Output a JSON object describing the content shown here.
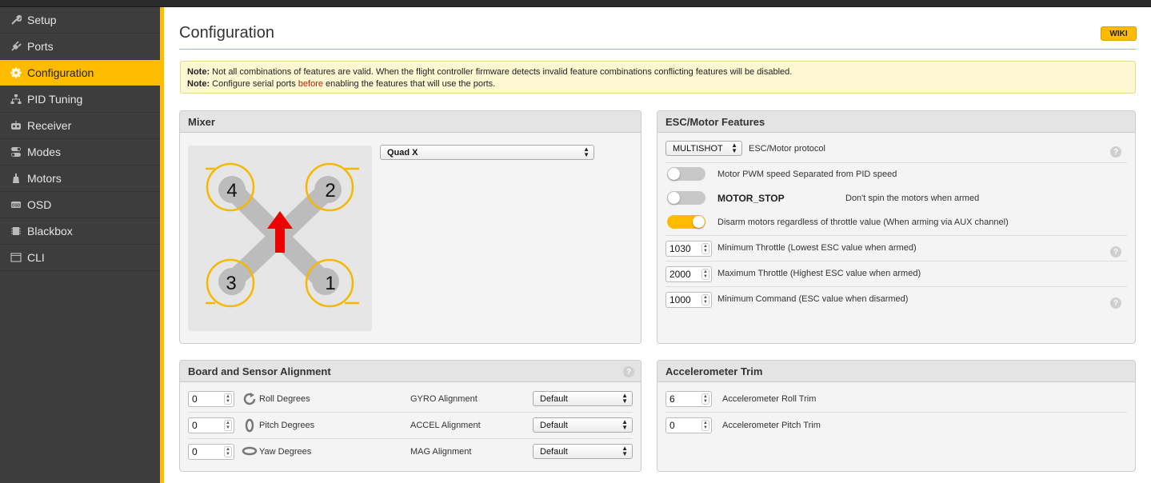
{
  "sidebar": {
    "items": [
      {
        "label": "Setup",
        "icon": "wrench-icon"
      },
      {
        "label": "Ports",
        "icon": "plug-icon"
      },
      {
        "label": "Configuration",
        "icon": "gear-icon"
      },
      {
        "label": "PID Tuning",
        "icon": "sitemap-icon"
      },
      {
        "label": "Receiver",
        "icon": "remote-icon"
      },
      {
        "label": "Modes",
        "icon": "toggles-icon"
      },
      {
        "label": "Motors",
        "icon": "motor-icon"
      },
      {
        "label": "OSD",
        "icon": "osd-icon"
      },
      {
        "label": "Blackbox",
        "icon": "blackbox-icon"
      },
      {
        "label": "CLI",
        "icon": "terminal-icon"
      }
    ],
    "active": "Configuration",
    "accent_color": "#ffbb00"
  },
  "header": {
    "title": "Configuration",
    "wiki_label": "WIKI"
  },
  "note": {
    "line1_prefix": "Note:",
    "line1_text": " Not all combinations of features are valid. When the flight controller firmware detects invalid feature combinations conflicting features will be disabled.",
    "line2_prefix": "Note:",
    "line2_text_a": " Configure serial ports ",
    "line2_emph": "before",
    "line2_text_b": " enabling the features that will use the ports."
  },
  "mixer": {
    "title": "Mixer",
    "selected": "Quad X",
    "motor_labels": [
      "4",
      "2",
      "3",
      "1"
    ]
  },
  "esc": {
    "title": "ESC/Motor Features",
    "protocol_value": "MULTISHOT",
    "protocol_label": "ESC/Motor protocol",
    "pwm_label": "Motor PWM speed Separated from PID speed",
    "motor_stop_label": "MOTOR_STOP",
    "motor_stop_desc": "Don't spin the motors when armed",
    "disarm_label": "Disarm motors regardless of throttle value (When arming via AUX channel)",
    "toggles": {
      "pwm": false,
      "motor_stop": false,
      "disarm": true
    },
    "min_throttle": "1030",
    "min_throttle_label": "Minimum Throttle (Lowest ESC value when armed)",
    "max_throttle": "2000",
    "max_throttle_label": "Maximum Throttle (Highest ESC value when armed)",
    "min_command": "1000",
    "min_command_label": "Minimum Command (ESC value when disarmed)"
  },
  "alignment": {
    "title": "Board and Sensor Alignment",
    "rows": [
      {
        "value": "0",
        "label": "Roll Degrees",
        "sensor": "GYRO Alignment",
        "option": "Default"
      },
      {
        "value": "0",
        "label": "Pitch Degrees",
        "sensor": "ACCEL Alignment",
        "option": "Default"
      },
      {
        "value": "0",
        "label": "Yaw Degrees",
        "sensor": "MAG Alignment",
        "option": "Default"
      }
    ]
  },
  "acc_trim": {
    "title": "Accelerometer Trim",
    "roll_value": "6",
    "roll_label": "Accelerometer Roll Trim",
    "pitch_value": "0",
    "pitch_label": "Accelerometer Pitch Trim"
  },
  "help_glyph": "?"
}
